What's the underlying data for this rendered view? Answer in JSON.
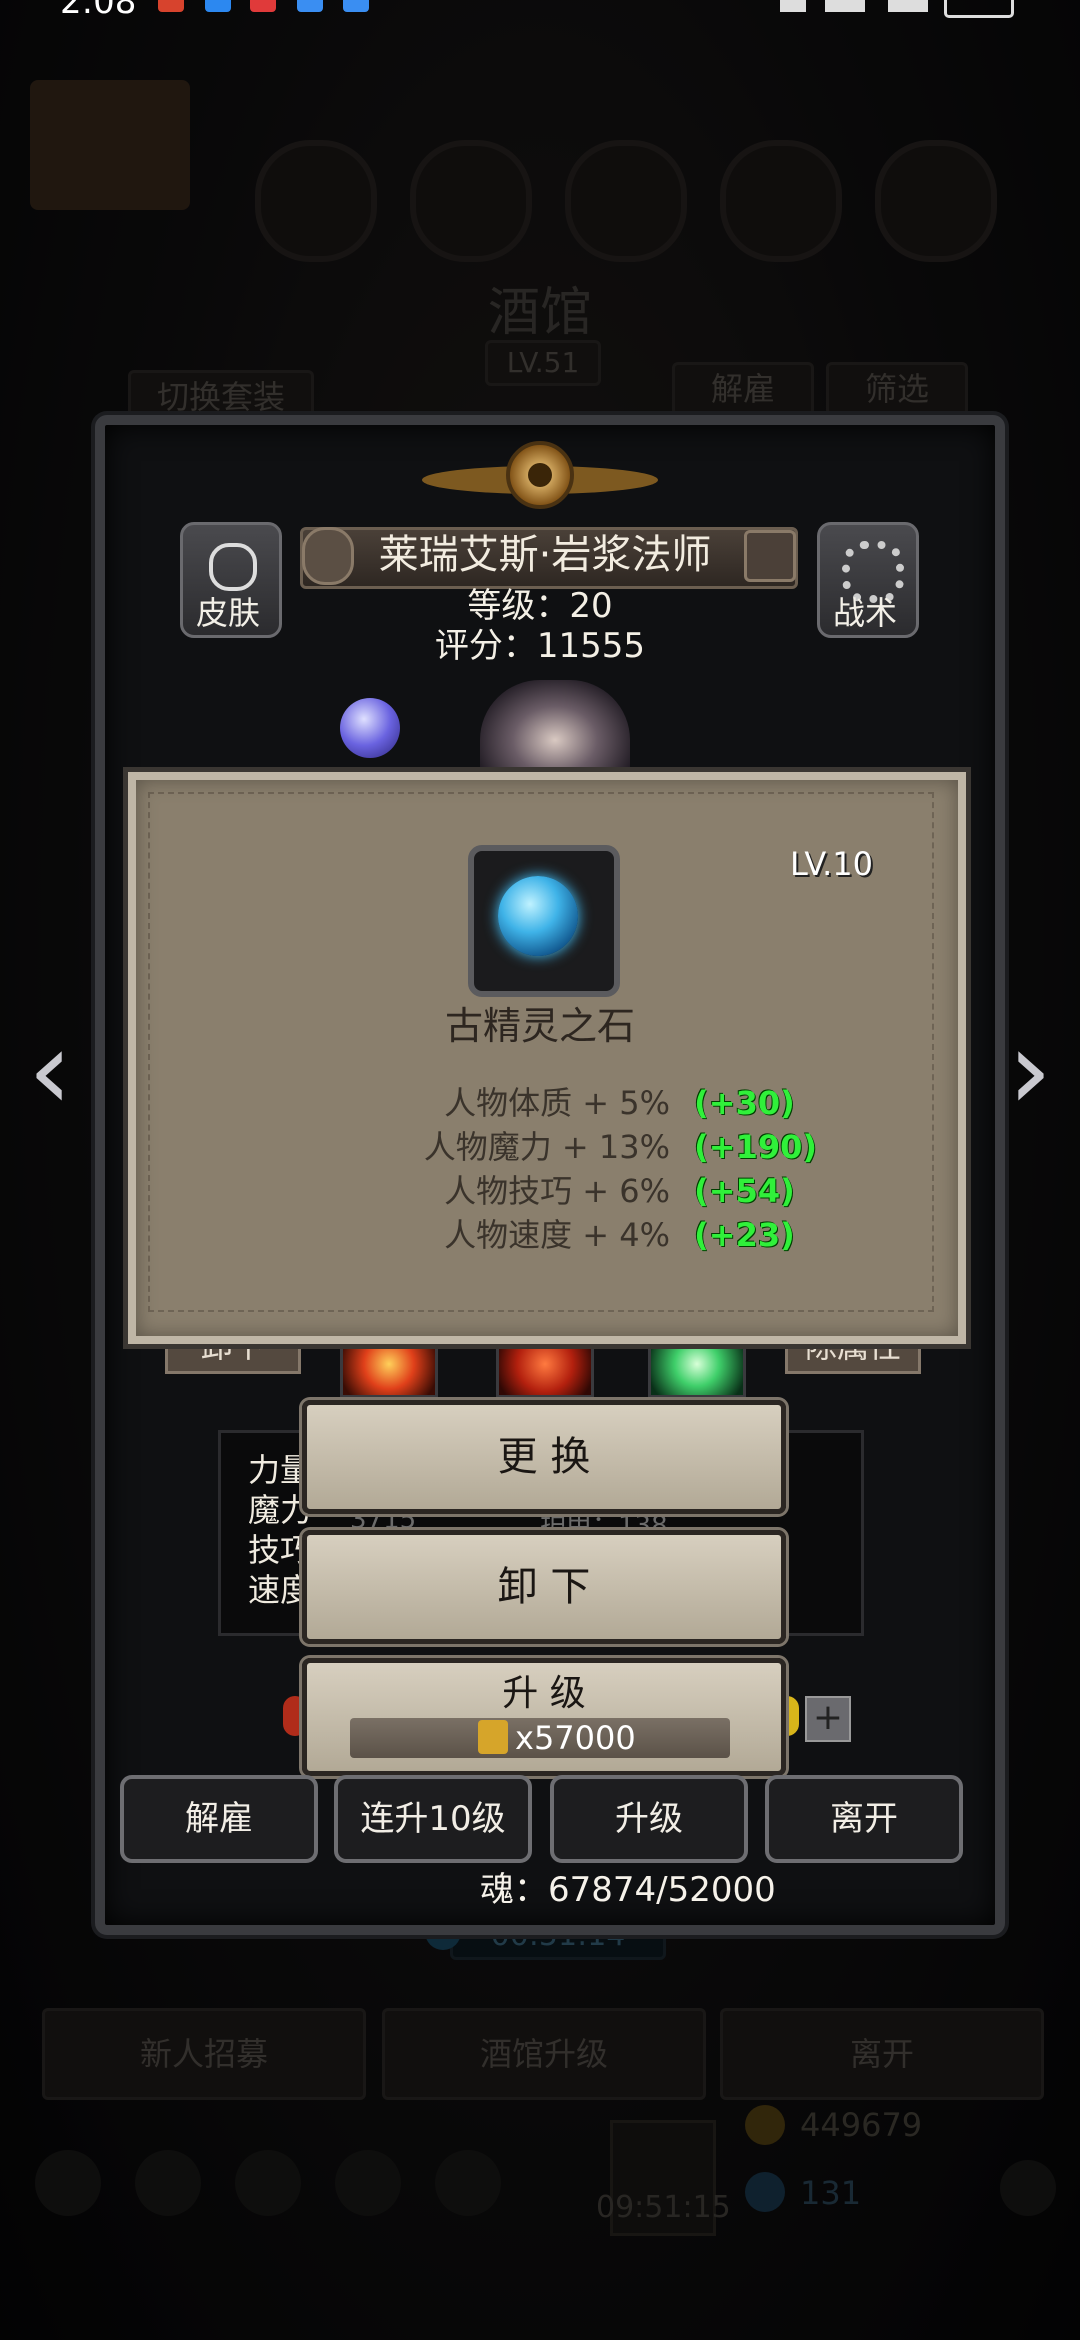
{
  "status_bar": {
    "time": "2:08"
  },
  "background": {
    "title": "酒馆",
    "level": "LV.51",
    "switch_outfit": "切换套装",
    "dismiss": "解雇",
    "filter": "筛选",
    "timer_top": "00:51:14",
    "recruit": "新人招募",
    "tavern_upgrade": "酒馆升级",
    "leave": "离开",
    "gold": "449679",
    "timer_bottom": "09:51:15",
    "gems": "131"
  },
  "hero": {
    "name": "莱瑞艾斯·岩浆法师",
    "level_text": "等级：20",
    "score_text": "评分：11555",
    "skin_label": "皮肤",
    "tactics_label": "战术",
    "partial_left": "卸下",
    "partial_right": "除属性",
    "stats_partial": [
      "力量",
      "魔力",
      "技巧",
      "速度"
    ],
    "stat_numbers_partial": [
      "3715",
      "护甲：138"
    ]
  },
  "popup": {
    "item_level": "LV.10",
    "item_name": "古精灵之石",
    "bonuses": [
      {
        "text": "人物体质 + 5%",
        "extra": "(+30)"
      },
      {
        "text": "人物魔力 + 13%",
        "extra": "(+190)"
      },
      {
        "text": "人物技巧 + 6%",
        "extra": "(+54)"
      },
      {
        "text": "人物速度 + 4%",
        "extra": "(+23)"
      }
    ]
  },
  "actions": {
    "replace": "更 换",
    "unequip": "卸 下",
    "upgrade": "升 级",
    "upgrade_cost": "x57000"
  },
  "bottom_buttons": {
    "dismiss": "解雇",
    "level10": "连升10级",
    "upgrade": "升级",
    "leave": "离开"
  },
  "soul": "魂：67874/52000",
  "colors": {
    "bonus_green": "#30f03a",
    "popup_bg": "#8a7f6d"
  }
}
